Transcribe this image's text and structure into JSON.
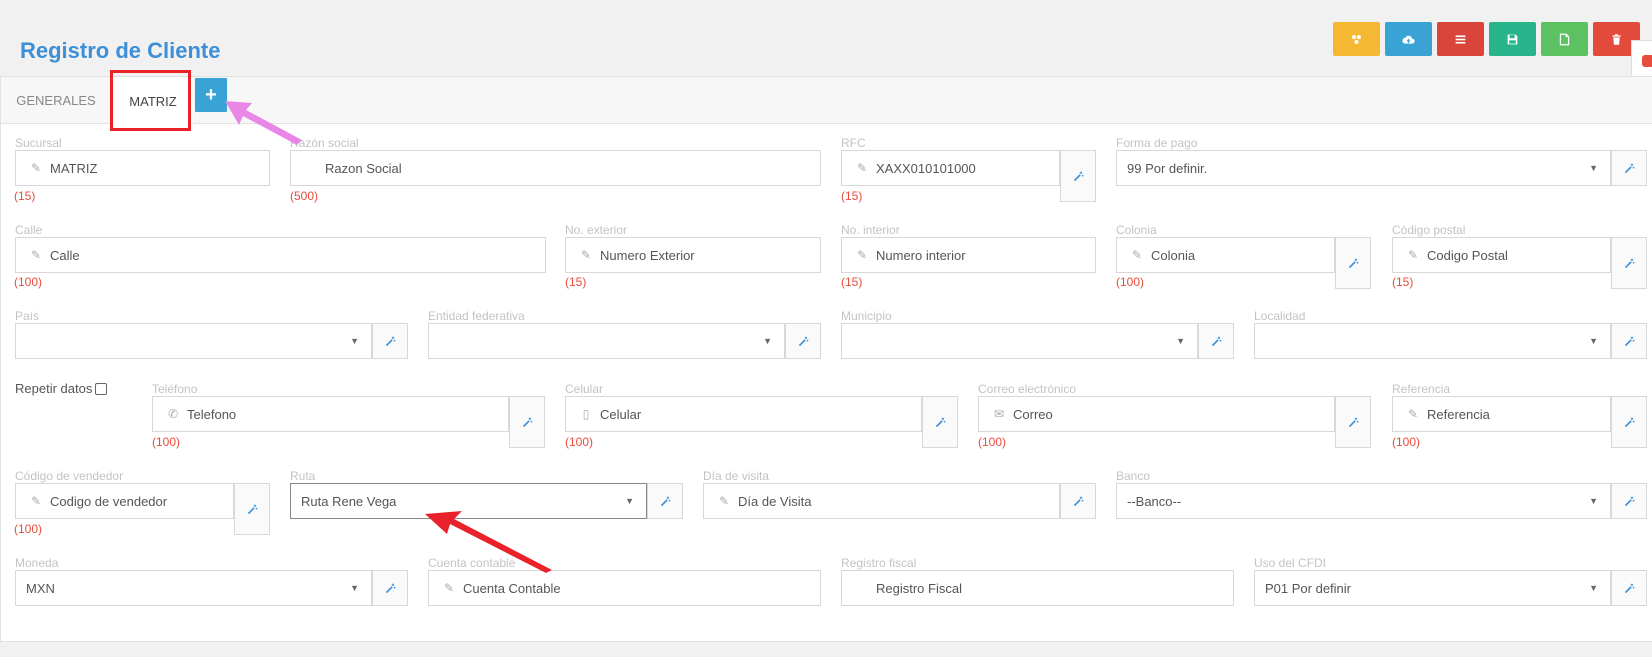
{
  "page": {
    "title": "Registro de Cliente"
  },
  "toolbar": {
    "buttons": [
      {
        "name": "users-button",
        "icon": "users-icon",
        "color": "#f5b833"
      },
      {
        "name": "cloud-upload-button",
        "icon": "cloud-upload-icon",
        "color": "#3aa3d6"
      },
      {
        "name": "list-button",
        "icon": "list-icon",
        "color": "#d9453a"
      },
      {
        "name": "save-button",
        "icon": "save-icon",
        "color": "#29b48c"
      },
      {
        "name": "new-document-button",
        "icon": "file-icon",
        "color": "#5cc160"
      },
      {
        "name": "delete-button",
        "icon": "trash-icon",
        "color": "#e24b3b"
      }
    ]
  },
  "tabs": {
    "generales": "GENERALES",
    "matriz": "MATRIZ",
    "add": "+"
  },
  "form": {
    "sucursal": {
      "label": "Sucursal",
      "value": "MATRIZ",
      "count": "(15)"
    },
    "razon_social": {
      "label": "Razón social",
      "placeholder": "Razon Social",
      "count": "(500)"
    },
    "rfc": {
      "label": "RFC",
      "value": "XAXX010101000",
      "count": "(15)"
    },
    "forma_pago": {
      "label": "Forma de pago",
      "value": "99 Por definir."
    },
    "calle": {
      "label": "Calle",
      "placeholder": "Calle",
      "count": "(100)"
    },
    "no_exterior": {
      "label": "No. exterior",
      "placeholder": "Numero Exterior",
      "count": "(15)"
    },
    "no_interior": {
      "label": "No. interior",
      "placeholder": "Numero interior",
      "count": "(15)"
    },
    "colonia": {
      "label": "Colonia",
      "placeholder": "Colonia",
      "count": "(100)"
    },
    "codigo_postal": {
      "label": "Código postal",
      "placeholder": "Codigo Postal",
      "count": "(15)"
    },
    "pais": {
      "label": "País",
      "value": ""
    },
    "entidad": {
      "label": "Entidad federativa",
      "value": ""
    },
    "municipio": {
      "label": "Municipio",
      "value": ""
    },
    "localidad": {
      "label": "Localidad",
      "value": ""
    },
    "repetir_datos": {
      "label": "Repetir datos"
    },
    "telefono": {
      "label": "Teléfono",
      "placeholder": "Telefono",
      "count": "(100)"
    },
    "celular": {
      "label": "Celular",
      "placeholder": "Celular",
      "count": "(100)"
    },
    "correo": {
      "label": "Correo electrónico",
      "placeholder": "Correo",
      "count": "(100)"
    },
    "referencia": {
      "label": "Referencia",
      "placeholder": "Referencia",
      "count": "(100)"
    },
    "codigo_vendedor": {
      "label": "Código de vendedor",
      "placeholder": "Codigo de vendedor",
      "count": "(100)"
    },
    "ruta": {
      "label": "Ruta",
      "value": "Ruta Rene Vega"
    },
    "dia_visita": {
      "label": "Día de visita",
      "placeholder": "Día de Visita"
    },
    "banco": {
      "label": "Banco",
      "value": "--Banco--"
    },
    "moneda": {
      "label": "Moneda",
      "value": "MXN"
    },
    "cuenta_contable": {
      "label": "Cuenta contable",
      "placeholder": "Cuenta Contable"
    },
    "registro_fiscal": {
      "label": "Registro fiscal",
      "placeholder": "Registro Fiscal"
    },
    "uso_cfdi": {
      "label": "Uso del CFDI",
      "value": "P01 Por definir"
    }
  }
}
